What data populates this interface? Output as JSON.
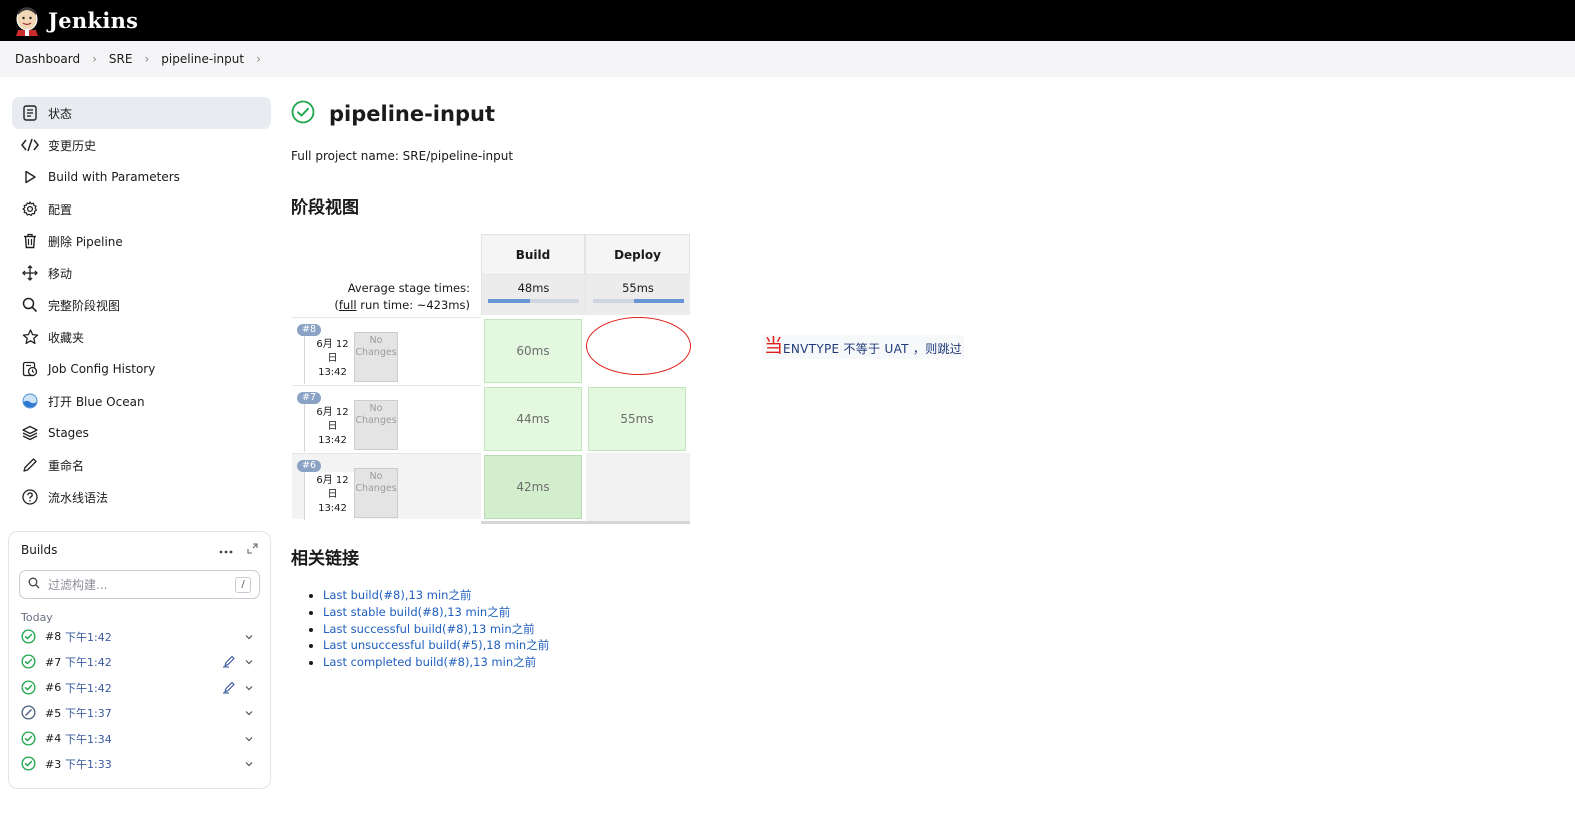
{
  "header": {
    "app_name": "Jenkins"
  },
  "breadcrumb": [
    {
      "label": "Dashboard"
    },
    {
      "label": "SRE"
    },
    {
      "label": "pipeline-input"
    }
  ],
  "sidebar": {
    "items": [
      {
        "label": "状态",
        "icon": "status-icon"
      },
      {
        "label": "变更历史",
        "icon": "code-icon"
      },
      {
        "label": "Build with Parameters",
        "icon": "play-icon"
      },
      {
        "label": "配置",
        "icon": "gear-icon"
      },
      {
        "label": "删除 Pipeline",
        "icon": "trash-icon"
      },
      {
        "label": "移动",
        "icon": "move-icon"
      },
      {
        "label": "完整阶段视图",
        "icon": "search-icon"
      },
      {
        "label": "收藏夹",
        "icon": "star-icon"
      },
      {
        "label": "Job Config History",
        "icon": "history-icon"
      },
      {
        "label": "打开 Blue Ocean",
        "icon": "blue-ocean-icon"
      },
      {
        "label": "Stages",
        "icon": "stages-icon"
      },
      {
        "label": "重命名",
        "icon": "pencil-icon"
      },
      {
        "label": "流水线语法",
        "icon": "help-icon"
      }
    ]
  },
  "builds": {
    "title": "Builds",
    "filter_placeholder": "过滤构建...",
    "filter_shortcut": "/",
    "group_label": "Today",
    "rows": [
      {
        "num": "#8",
        "time": "下午1:42",
        "status": "success",
        "has_input_icon": false
      },
      {
        "num": "#7",
        "time": "下午1:42",
        "status": "success",
        "has_input_icon": true
      },
      {
        "num": "#6",
        "time": "下午1:42",
        "status": "success",
        "has_input_icon": true
      },
      {
        "num": "#5",
        "time": "下午1:37",
        "status": "aborted",
        "has_input_icon": false
      },
      {
        "num": "#4",
        "time": "下午1:34",
        "status": "success",
        "has_input_icon": false
      },
      {
        "num": "#3",
        "time": "下午1:33",
        "status": "success",
        "has_input_icon": false
      }
    ]
  },
  "main": {
    "title": "pipeline-input",
    "full_name": "Full project name: SRE/pipeline-input",
    "stage_view_heading": "阶段视图",
    "related_heading": "相关链接"
  },
  "stage_view": {
    "stages": [
      {
        "name": "Build",
        "avg": "48ms",
        "bar_fraction": 0.46
      },
      {
        "name": "Deploy",
        "avg": "55ms",
        "bar_fraction": 0.54
      }
    ],
    "avg_label": "Average stage times:",
    "run_time_prefix": "(",
    "run_time_link": "full",
    "run_time_suffix": " run time: ~423ms)",
    "runs": [
      {
        "badge": "#8",
        "date_line1": "6月 12",
        "date_line2": "日",
        "date_line3": "13:42",
        "changes_line1": "No",
        "changes_line2": "Changes",
        "build": "60ms",
        "deploy": ""
      },
      {
        "badge": "#7",
        "date_line1": "6月 12",
        "date_line2": "日",
        "date_line3": "13:42",
        "changes_line1": "No",
        "changes_line2": "Changes",
        "build": "44ms",
        "deploy": "55ms"
      },
      {
        "badge": "#6",
        "date_line1": "6月 12",
        "date_line2": "日",
        "date_line3": "13:42",
        "changes_line1": "No",
        "changes_line2": "Changes",
        "build": "42ms",
        "deploy": ""
      }
    ]
  },
  "annotation": {
    "lead": "当",
    "text": "ENVTYPE  不等于  UAT  ，则跳过"
  },
  "related_links": [
    "Last build(#8),13 min之前",
    "Last stable build(#8),13 min之前",
    "Last successful build(#8),13 min之前",
    "Last unsuccessful build(#5),18 min之前",
    "Last completed build(#8),13 min之前"
  ],
  "colors": {
    "header_bg": "#000000",
    "success_green": "#1ea64b",
    "link_blue": "#1f5fbf",
    "annotation_red": "#e0201b"
  }
}
